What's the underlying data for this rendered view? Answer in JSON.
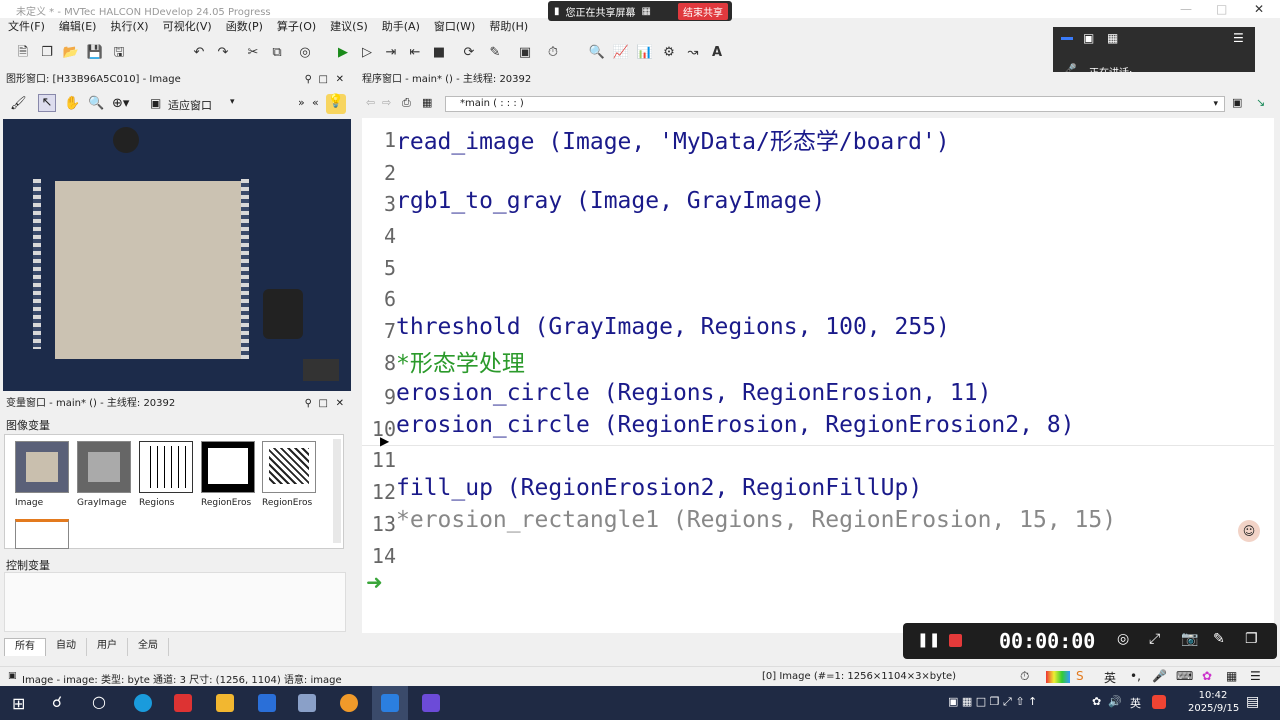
{
  "titlebar": {
    "title": "未定义 * - MVTec HALCON HDevelop 24.05 Progress"
  },
  "share": {
    "text": "您正在共享屏幕",
    "end_label": "结束共享"
  },
  "menu": [
    "文件(F)",
    "编辑(E)",
    "执行(X)",
    "可视化(V)",
    "函数(P)",
    "算子(O)",
    "建议(S)",
    "助手(A)",
    "窗口(W)",
    "帮助(H)"
  ],
  "meeting": {
    "speaking_label": "正在讲话:"
  },
  "graphics_window": {
    "header": "图形窗口: [H33B96A5C010] - Image",
    "fit_label": "适应窗口"
  },
  "variable_window": {
    "header": "变量窗口 - main* () - 主线程: 20392",
    "image_vars_label": "图像变量",
    "thumbnails": [
      "Image",
      "GrayImage",
      "Regions",
      "RegionEros",
      "RegionEros"
    ],
    "control_vars_label": "控制变量",
    "tabs": [
      "所有",
      "自动",
      "用户",
      "全局"
    ]
  },
  "program_window": {
    "header": "程序窗口 - main* () - 主线程: 20392",
    "proc_select": "*main ( : : : )",
    "lines": [
      {
        "n": "1",
        "code": "read_image (Image, 'MyData/形态学/board')",
        "style": "normal"
      },
      {
        "n": "2",
        "code": "",
        "style": "normal"
      },
      {
        "n": "3",
        "code": "rgb1_to_gray (Image, GrayImage)",
        "style": "normal"
      },
      {
        "n": "4",
        "code": "",
        "style": "normal"
      },
      {
        "n": "5",
        "code": "",
        "style": "normal"
      },
      {
        "n": "6",
        "code": "",
        "style": "normal"
      },
      {
        "n": "7",
        "code": "threshold (GrayImage, Regions, 100, 255)",
        "style": "normal"
      },
      {
        "n": "8",
        "code": "*形态学处理",
        "style": "comment"
      },
      {
        "n": "9",
        "code": "erosion_circle (Regions, RegionErosion, 11)",
        "style": "normal"
      },
      {
        "n": "10",
        "code": "erosion_circle (RegionErosion, RegionErosion2, 8)",
        "style": "normal"
      },
      {
        "n": "11",
        "code": "",
        "style": "normal"
      },
      {
        "n": "12",
        "code": "fill_up (RegionErosion2, RegionFillUp)",
        "style": "normal"
      },
      {
        "n": "13",
        "code": "*erosion_rectangle1 (Regions, RegionErosion, 15, 15)",
        "style": "disabled"
      },
      {
        "n": "14",
        "code": "",
        "style": "normal"
      }
    ]
  },
  "recorder": {
    "time": "00:00:00"
  },
  "statusbar": {
    "left": "Image - image: 类型: byte 通道: 3 尺寸: (1256, 1104) 语意: image",
    "right": "[0] Image (#=1: 1256×1104×3×byte)"
  },
  "tray": {
    "ime": "英",
    "ime2": "英"
  },
  "clock": {
    "time": "10:42",
    "date": "2025/9/15"
  },
  "colors": {
    "accent": "#0078d7",
    "code": "#1a1a8a",
    "comment": "#2b9a2b",
    "taskbar": "#1f2a44"
  }
}
